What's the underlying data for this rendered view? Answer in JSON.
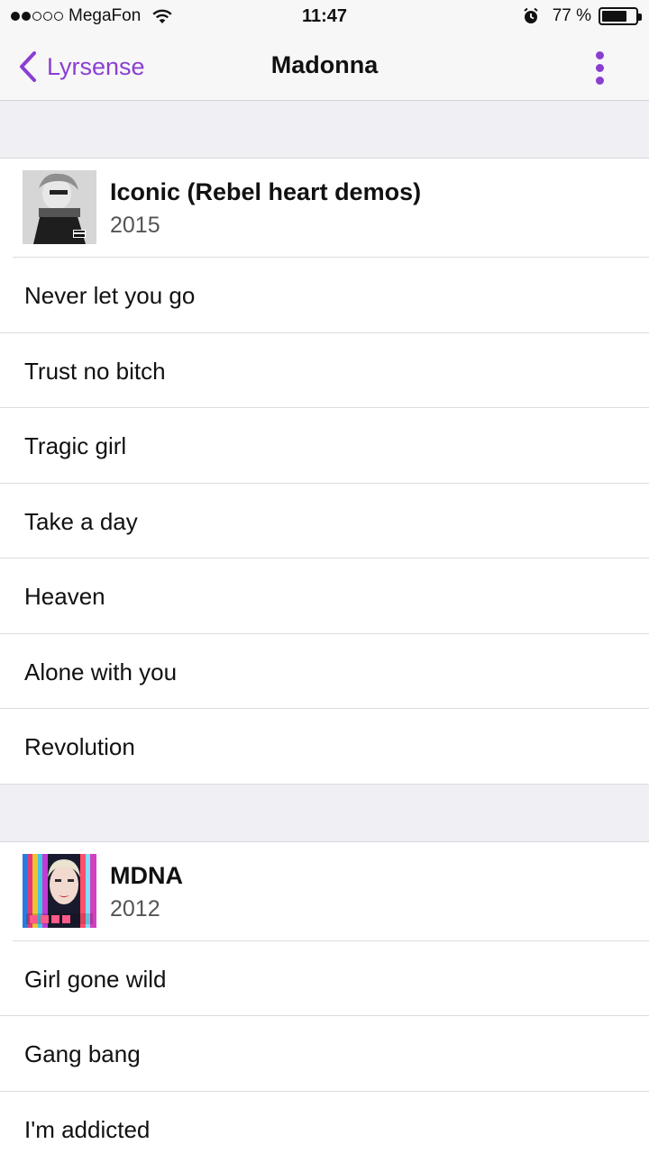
{
  "status_bar": {
    "carrier": "MegaFon",
    "time": "11:47",
    "battery_percent": "77 %",
    "battery_level": 0.77,
    "signal_bars_filled": 2,
    "signal_bars_total": 5
  },
  "nav": {
    "back_label": "Lyrsense",
    "title": "Madonna",
    "accent_color": "#8a3fd1"
  },
  "albums": [
    {
      "title": "Iconic (Rebel heart demos)",
      "year": "2015",
      "tracks": [
        "Never let you go",
        "Trust no bitch",
        "Tragic girl",
        "Take a day",
        "Heaven",
        "Alone with you",
        "Revolution"
      ]
    },
    {
      "title": "MDNA",
      "year": "2012",
      "tracks": [
        "Girl gone wild",
        "Gang bang",
        "I'm addicted"
      ]
    }
  ],
  "icons": {
    "back": "chevron-left-icon",
    "more": "more-vertical-icon",
    "wifi": "wifi-icon",
    "alarm": "alarm-icon",
    "battery": "battery-icon"
  }
}
